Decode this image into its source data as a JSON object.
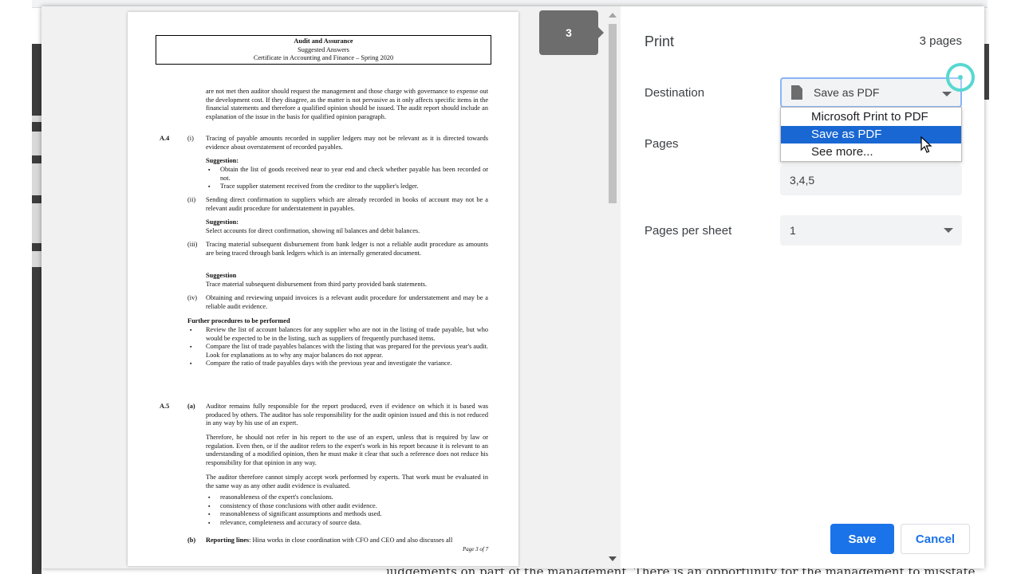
{
  "background": {
    "bottom_text": "judgements on part of the management. There is an opportunity for the management to misstate"
  },
  "preview": {
    "page_badge": "3",
    "document": {
      "header": {
        "title": "Audit and Assurance",
        "subtitle": "Suggested Answers",
        "course": "Certificate in Accounting and Finance – Spring 2020"
      },
      "intro_para": "are not met then auditor should request the management and those charge with governance to expense out the development cost. If they disagree, as the matter is not pervasive as it only affects specific items in the financial statements and therefore a qualified opinion should be issued. The audit report should include an explanation of the issue in the basis for qualified opinion paragraph.",
      "a4_label": "A.4",
      "a4_i_num": "(i)",
      "a4_i_text": "Tracing of payable amounts recorded in supplier ledgers may not be relevant as it is directed towards evidence about overstatement of recorded payables.",
      "a4_i_sugg": "Suggestion:",
      "a4_i_b1": "Obtain the list of goods received near to year end and check whether payable has been recorded or not.",
      "a4_i_b2": "Trace supplier statement received from the creditor to the supplier's ledger.",
      "a4_ii_num": "(ii)",
      "a4_ii_text": "Sending direct confirmation to suppliers which are already recorded in books of account may not be a relevant audit procedure for understatement in payables.",
      "a4_ii_sugg": "Suggestion:",
      "a4_ii_sugg_text": "Select accounts for direct confirmation, showing nil balances and debit balances.",
      "a4_iii_num": "(iii)",
      "a4_iii_text": "Tracing material subsequent disbursement from bank ledger is not a reliable audit procedure as amounts are being traced through bank ledgers which is an internally generated document.",
      "a4_iii_sugg": "Suggestion",
      "a4_iii_sugg_text": "Trace material subsequent disbursement from third party provided bank statements.",
      "a4_iv_num": "(iv)",
      "a4_iv_text": "Obtaining and reviewing unpaid invoices is a relevant audit procedure for understatement and may be a reliable audit evidence.",
      "further_title": "Further procedures to be performed",
      "further_b1": "Review the list of account balances for any supplier who are not in the listing of trade payable, but who would be expected to be in the listing, such as suppliers of frequently purchased items.",
      "further_b2": "Compare the list of trade payables balances with the listing that was prepared for the previous year's audit. Look for explanations as to why any major balances do not appear.",
      "further_b3": "Compare the ratio of trade payables days with the previous year and investigate the variance.",
      "a5_label": "A.5",
      "a5_a_num": "(a)",
      "a5_a_p1": "Auditor remains fully responsible for the report produced, even if evidence on which it is based was produced by others. The auditor has sole responsibility for the audit opinion issued and this is not reduced in any way by his use of an expert.",
      "a5_a_p2": "Therefore, he should not refer in his report to the use of an expert, unless that is required by law or regulation. Even then, or if the auditor refers to the expert's work in his report because it is relevant to an understanding of a modified opinion, then he must make it clear that such a reference does not reduce his responsibility for that opinion in any way.",
      "a5_a_p3": "The auditor therefore cannot simply accept work performed by experts. That work must be evaluated in the same way as any other audit evidence is evaluated.",
      "a5_a_b1": "reasonableness of the expert's conclusions.",
      "a5_a_b2": "consistency of those conclusions with other audit evidence.",
      "a5_a_b3": "reasonableness of significant assumptions and methods used.",
      "a5_a_b4": "relevance, completeness and accuracy of source data.",
      "a5_b_num": "(b)",
      "a5_b_bold": "Reporting lines",
      "a5_b_text": ": Hina works in close coordination with CFO and CEO and also discusses all",
      "footer": "Page 3 of 7"
    }
  },
  "settings": {
    "title": "Print",
    "pages_count": "3 pages",
    "destination_label": "Destination",
    "destination_value": "Save as PDF",
    "destination_options": [
      "Microsoft Print to PDF",
      "Save as PDF",
      "See more..."
    ],
    "pages_label": "Pages",
    "pages_value": "3,4,5",
    "pages_per_sheet_label": "Pages per sheet",
    "pages_per_sheet_value": "1",
    "save_label": "Save",
    "cancel_label": "Cancel"
  },
  "colors": {
    "accent": "#1a73e8",
    "selected_option": "#1967d2",
    "focus_ring": "#56d8d1"
  }
}
